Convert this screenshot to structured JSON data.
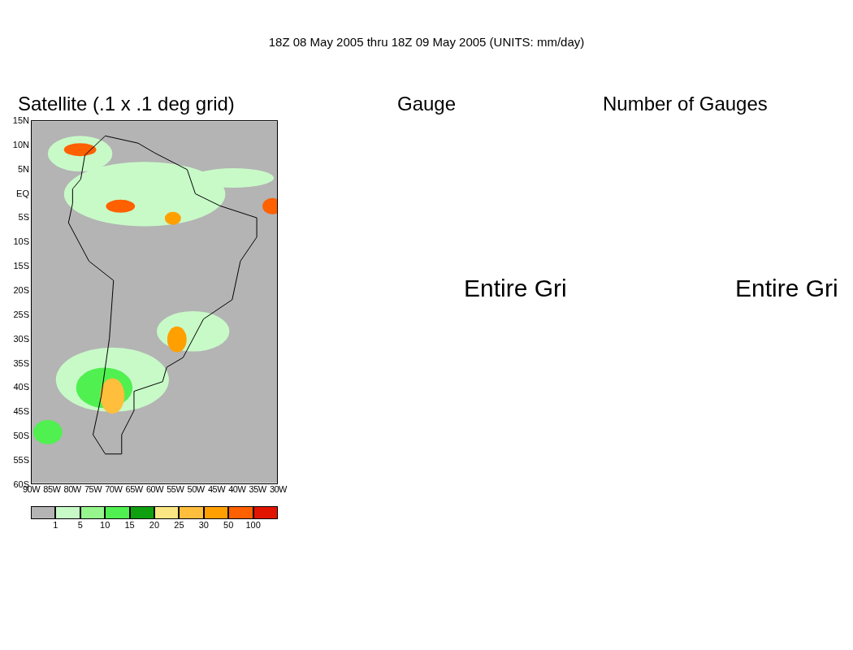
{
  "header": {
    "title": "18Z 08 May 2005 thru 18Z 09 May 2005 (UNITS: mm/day)"
  },
  "panels": [
    {
      "title": "Satellite (.1 x .1 deg grid)",
      "kind": "map"
    },
    {
      "title": "Gauge",
      "kind": "message",
      "message": "Entire Gri"
    },
    {
      "title": "Number of Gauges",
      "kind": "message",
      "message": "Entire Gri"
    }
  ],
  "map": {
    "lat_labels": [
      "15N",
      "10N",
      "5N",
      "EQ",
      "5S",
      "10S",
      "15S",
      "20S",
      "25S",
      "30S",
      "35S",
      "40S",
      "45S",
      "50S",
      "55S",
      "60S"
    ],
    "lon_labels": [
      "90W",
      "85W",
      "80W",
      "75W",
      "70W",
      "65W",
      "60W",
      "55W",
      "50W",
      "45W",
      "40W",
      "35W",
      "30W"
    ]
  },
  "legend": {
    "swatches": [
      {
        "color": "#b4b4b4"
      },
      {
        "color": "#c8fac8"
      },
      {
        "color": "#96f58c"
      },
      {
        "color": "#50f050"
      },
      {
        "color": "#0fa00f"
      },
      {
        "color": "#fae682"
      },
      {
        "color": "#ffbe3c"
      },
      {
        "color": "#ffa000"
      },
      {
        "color": "#ff6000"
      },
      {
        "color": "#e11400"
      }
    ],
    "labels": [
      "1",
      "5",
      "10",
      "15",
      "20",
      "25",
      "30",
      "50",
      "100"
    ]
  }
}
